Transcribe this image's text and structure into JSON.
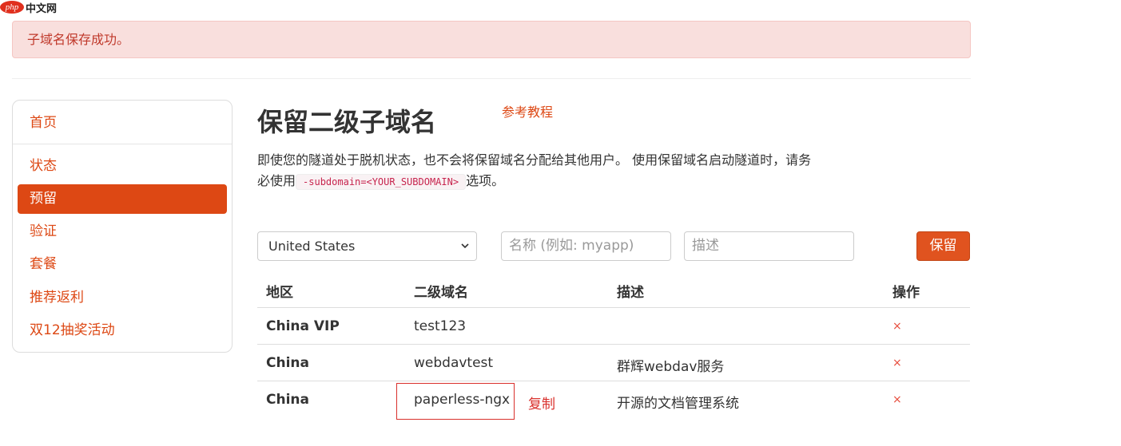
{
  "logo": {
    "php": "php",
    "site": "中文网"
  },
  "alert": {
    "message": "子域名保存成功。"
  },
  "sidebar": {
    "items": [
      {
        "label": "首页",
        "active": false
      },
      {
        "label": "状态",
        "active": false
      },
      {
        "label": "预留",
        "active": true
      },
      {
        "label": "验证",
        "active": false
      },
      {
        "label": "套餐",
        "active": false
      },
      {
        "label": "推荐返利",
        "active": false
      },
      {
        "label": "双12抽奖活动",
        "active": false
      }
    ]
  },
  "main": {
    "title": "保留二级子域名",
    "ref_link": "参考教程",
    "desc_part1": "即使您的隧道处于脱机状态，也不会将保留域名分配给其他用户。 使用保留域名启动隧道时，请务必使用",
    "desc_code": "-subdomain=<YOUR_SUBDOMAIN>",
    "desc_part2": "选项。"
  },
  "form": {
    "region_selected": "United States",
    "name_placeholder": "名称 (例如: myapp)",
    "desc_placeholder": "描述",
    "save_label": "保留"
  },
  "table": {
    "headers": [
      "地区",
      "二级域名",
      "描述",
      "操作"
    ],
    "rows": [
      {
        "region": "China VIP",
        "subdomain": "test123",
        "desc": "",
        "action": "×"
      },
      {
        "region": "China",
        "subdomain": "webdavtest",
        "desc": "群辉webdav服务",
        "action": "×"
      },
      {
        "region": "China",
        "subdomain": "paperless-ngx",
        "desc": "开源的文档管理系统",
        "action": "×"
      }
    ]
  },
  "annotation": {
    "copy_label": "复制"
  },
  "colors": {
    "accent": "#dd4814",
    "alert_bg": "#f9dfdd",
    "alert_text": "#c0392b",
    "delete": "#e74c3c"
  }
}
